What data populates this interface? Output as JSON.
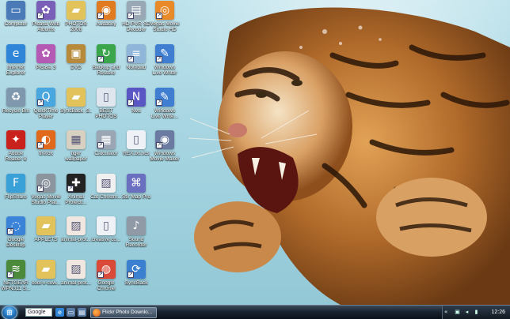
{
  "desktop": {
    "icons": [
      {
        "label": "Computer",
        "icon": "computer-icon",
        "color": "#4a7ab8",
        "glyph": "▭"
      },
      {
        "label": "Picasa Web Albums",
        "icon": "picasa-icon",
        "color": "#7a5fb8",
        "glyph": "✿"
      },
      {
        "label": "PHOTOS 2008",
        "icon": "folder-icon",
        "color": "#e2c25a",
        "glyph": "▰"
      },
      {
        "label": "Audacity",
        "icon": "audacity-icon",
        "color": "#e07b22",
        "glyph": "◉"
      },
      {
        "label": "HD-PVR SD Decoder",
        "icon": "hdpvr-icon",
        "color": "#9aa8b6",
        "glyph": "▤"
      },
      {
        "label": "Vegas Movie Studio HD",
        "icon": "vegas-icon",
        "color": "#e88a2a",
        "glyph": "◎"
      },
      {
        "label": "Internet Explorer",
        "icon": "ie-icon",
        "color": "#2f86d9",
        "glyph": "e"
      },
      {
        "label": "Picasa 3",
        "icon": "picasa3-icon",
        "color": "#b55ab4",
        "glyph": "✿"
      },
      {
        "label": "DVD",
        "icon": "dvd-icon",
        "color": "#b68a3a",
        "glyph": "▣"
      },
      {
        "label": "Backup and Restore",
        "icon": "backup-icon",
        "color": "#3aa54a",
        "glyph": "↻"
      },
      {
        "label": "Notepad",
        "icon": "notepad-icon",
        "color": "#8fb5d8",
        "glyph": "≡"
      },
      {
        "label": "Windows Live Writer",
        "icon": "live-writer-icon",
        "color": "#3f7ed0",
        "glyph": "✎"
      },
      {
        "label": "Recycle Bin",
        "icon": "recycle-bin-icon",
        "color": "#7f98ad",
        "glyph": "♻"
      },
      {
        "label": "QuickTime Player",
        "icon": "quicktime-icon",
        "color": "#4aa6de",
        "glyph": "Q"
      },
      {
        "label": "SyncBack_S...",
        "icon": "folder-icon",
        "color": "#e2c25a",
        "glyph": "▰"
      },
      {
        "label": "BEST PHOTOS",
        "icon": "document-icon",
        "color": "#dfe6ee",
        "glyph": "▯"
      },
      {
        "label": "Nvu",
        "icon": "nvu-icon",
        "color": "#5a56c4",
        "glyph": "N"
      },
      {
        "label": "Windows Live Write...",
        "icon": "live-writer-icon",
        "color": "#3f7ed0",
        "glyph": "✎"
      },
      {
        "label": "Adobe Reader 8",
        "icon": "adobe-reader-icon",
        "color": "#c9221d",
        "glyph": "✦"
      },
      {
        "label": "firefox",
        "icon": "firefox-icon",
        "color": "#e0691b",
        "glyph": "◐"
      },
      {
        "label": "tiger wallpaper",
        "icon": "image-icon",
        "color": "#d8d0c0",
        "glyph": "▦"
      },
      {
        "label": "Calculator",
        "icon": "calculator-icon",
        "color": "#9aa6b4",
        "glyph": "▦"
      },
      {
        "label": "REX.txt.vcs",
        "icon": "text-file-icon",
        "color": "#eef2f6",
        "glyph": "▯"
      },
      {
        "label": "Windows Movie Maker",
        "icon": "movie-maker-icon",
        "color": "#6a7aa0",
        "glyph": "◉"
      },
      {
        "label": "FlipShare",
        "icon": "flipshare-icon",
        "color": "#3aa0d8",
        "glyph": "F"
      },
      {
        "label": "Vegas Movie Studio Plat...",
        "icon": "vegas-platinum-icon",
        "color": "#8c959e",
        "glyph": "◎"
      },
      {
        "label": "Animal Protecti...",
        "icon": "animal-protection-icon",
        "color": "#222222",
        "glyph": "✚"
      },
      {
        "label": "Cat Christm...",
        "icon": "image-file-icon",
        "color": "#f0f0f0",
        "glyph": "▨"
      },
      {
        "label": "Stir Map Pro",
        "icon": "map-icon",
        "color": "#6a6fc0",
        "glyph": "⌘"
      },
      {
        "label": "Google Desktop",
        "icon": "google-desktop-icon",
        "color": "#3b83d8",
        "glyph": "◌"
      },
      {
        "label": "APPLETS",
        "icon": "folder-icon",
        "color": "#e2c25a",
        "glyph": "▰"
      },
      {
        "label": "animal-prot...",
        "icon": "image-file-icon",
        "color": "#f0e8e0",
        "glyph": "▨"
      },
      {
        "label": "creative co...",
        "icon": "document-icon",
        "color": "#eef2f6",
        "glyph": "▯"
      },
      {
        "label": "Sound Recorder",
        "icon": "sound-recorder-icon",
        "color": "#8f9aa6",
        "glyph": "♪"
      },
      {
        "label": "NETGEAR WPN311 S...",
        "icon": "netgear-icon",
        "color": "#4b8a3a",
        "glyph": "≋"
      },
      {
        "label": "cool-v-cow...",
        "icon": "folder-icon",
        "color": "#e2c25a",
        "glyph": "▰"
      },
      {
        "label": "animal-prot...",
        "icon": "image-file-icon",
        "color": "#f0e8e0",
        "glyph": "▨"
      },
      {
        "label": "Google Chrome",
        "icon": "chrome-icon",
        "color": "#d94a38",
        "glyph": "◍"
      },
      {
        "label": "SyncBack",
        "icon": "syncback-icon",
        "color": "#3a7fd0",
        "glyph": "⟳"
      }
    ]
  },
  "taskbar": {
    "start_label": "⊞",
    "search_text": "Google",
    "quick_launch": [
      {
        "icon": "ie-quicklaunch-icon",
        "color": "#2f86d9",
        "glyph": "e"
      },
      {
        "icon": "show-desktop-icon",
        "color": "#5a7da8",
        "glyph": "▭"
      },
      {
        "icon": "switch-windows-icon",
        "color": "#5a7da8",
        "glyph": "▤"
      }
    ],
    "task_button_label": "Flickr Photo Downlo...",
    "tray": {
      "chevron": "«",
      "icons": [
        {
          "icon": "network-icon",
          "glyph": "▣"
        },
        {
          "icon": "volume-icon",
          "glyph": "◂"
        },
        {
          "icon": "power-icon",
          "glyph": "▮"
        }
      ],
      "clock": "12:26"
    }
  },
  "colors": {
    "taskbar_dark": "#0a1018",
    "desktop_water": "#9fd0de"
  }
}
